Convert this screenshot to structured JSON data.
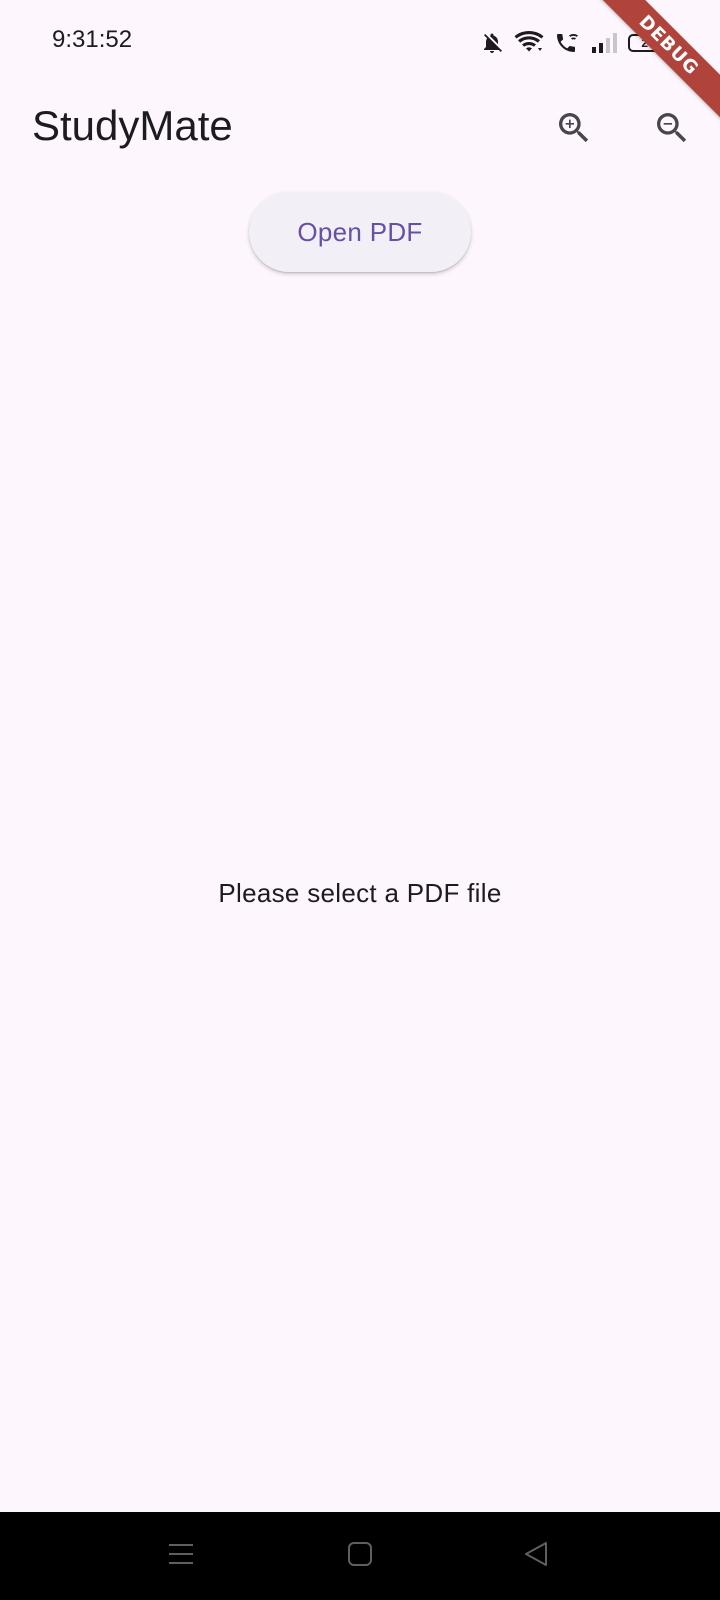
{
  "status_bar": {
    "time": "9:31:52",
    "battery_level": "24",
    "icons": [
      "bell-off-icon",
      "wifi-icon",
      "wifi-call-icon",
      "signal-icon",
      "battery-icon"
    ]
  },
  "debug_banner": {
    "label": "DEBUG",
    "color": "#b0443c"
  },
  "app_bar": {
    "title": "StudyMate",
    "actions": [
      {
        "name": "zoom-in",
        "icon": "zoom-in-icon"
      },
      {
        "name": "zoom-out",
        "icon": "zoom-out-icon"
      }
    ]
  },
  "main": {
    "open_pdf_label": "Open PDF",
    "empty_message": "Please select a PDF file"
  },
  "nav_bar": {
    "buttons": [
      "menu-icon",
      "home-icon",
      "back-icon"
    ]
  },
  "colors": {
    "background": "#fdf7fd",
    "primary": "#6750a4",
    "button_surface": "#f3eff6",
    "text": "#1d1b20"
  }
}
